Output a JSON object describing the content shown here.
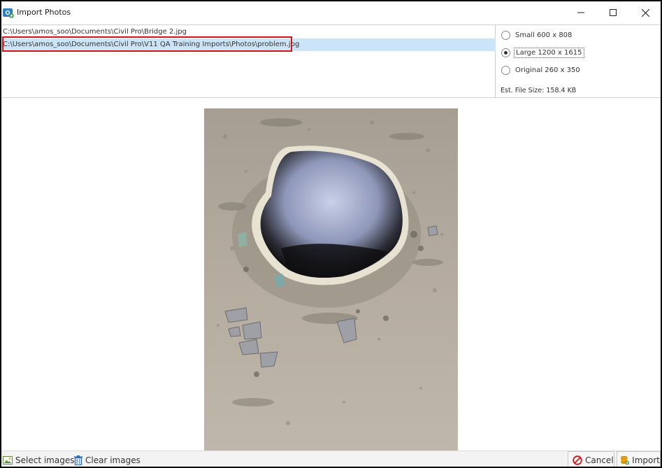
{
  "window": {
    "title": "Import Photos"
  },
  "files": [
    {
      "path": "C:\\Users\\amos_soo\\Documents\\Civil Pro\\Bridge 2.jpg",
      "selected": false
    },
    {
      "path": "C:\\Users\\amos_soo\\Documents\\Civil Pro\\V11 QA Training Imports\\Photos\\problem.jpg",
      "selected": true
    }
  ],
  "size_options": [
    {
      "label": "Small 600 x 808",
      "checked": false
    },
    {
      "label": "Large 1200 x 1615",
      "checked": true
    },
    {
      "label": "Original 260 x 350",
      "checked": false
    }
  ],
  "est_file_size": "Est. File Size: 158.4 KB",
  "toolbar": {
    "select_label": "Select images",
    "clear_label": "Clear images",
    "cancel_label": "Cancel",
    "import_label": "Import"
  },
  "colors": {
    "selection": "#cce4f7",
    "highlight_border": "#d0151b",
    "cancel_icon": "#d0151b",
    "import_icon": "#e8a317",
    "clear_icon": "#2a6fb8"
  },
  "icons": {
    "app": "photo-import-icon",
    "select": "image-icon",
    "clear": "trash-icon",
    "cancel": "prohibited-icon",
    "import": "database-add-icon"
  }
}
